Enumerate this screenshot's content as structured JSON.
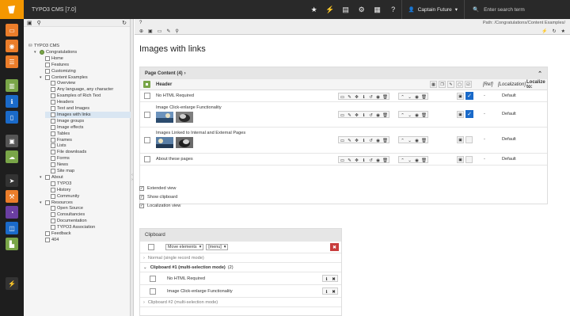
{
  "app": {
    "title": "TYPO3 CMS [7.0]"
  },
  "topbar": {
    "icons": [
      "bookmark-star-icon",
      "flash-icon",
      "documents-icon",
      "gear-icon",
      "grid-icon",
      "help-icon"
    ],
    "user": "Captain Future",
    "search_placeholder": "Enter search term"
  },
  "modules": [
    {
      "name": "page-module-icon",
      "color": "#eb7d2a"
    },
    {
      "name": "view-module-icon",
      "color": "#eb7d2a"
    },
    {
      "name": "list-module-icon",
      "color": "#eb7d2a"
    },
    {
      "name": "workspaces-module-icon",
      "color": "#79a548"
    },
    {
      "name": "info-module-icon",
      "color": "#1a6ac9"
    },
    {
      "name": "template-module-icon",
      "color": "#1a6ac9"
    },
    {
      "name": "filelist-module-icon",
      "color": "#555555"
    },
    {
      "name": "extension-module-icon",
      "color": "#79a548"
    },
    {
      "name": "launch-module-icon",
      "color": "#333333"
    },
    {
      "name": "install-module-icon",
      "color": "#eb7d2a"
    },
    {
      "name": "scheduler-module-icon",
      "color": "#6a3ea1"
    },
    {
      "name": "users-module-icon",
      "color": "#1a6ac9"
    },
    {
      "name": "reports-module-icon",
      "color": "#79a548"
    },
    {
      "name": "plug-icon",
      "color": "#333333"
    }
  ],
  "tree": {
    "root": "TYPO3 CMS",
    "nodes": [
      {
        "label": "Congratulations",
        "level": 1,
        "expanded": true
      },
      {
        "label": "Home",
        "level": 2
      },
      {
        "label": "Features",
        "level": 2
      },
      {
        "label": "Customizing",
        "level": 2
      },
      {
        "label": "Content Examples",
        "level": 2,
        "expanded": true
      },
      {
        "label": "Overview",
        "level": 3
      },
      {
        "label": "Any language, any character",
        "level": 3
      },
      {
        "label": "Examples of Rich Text",
        "level": 3
      },
      {
        "label": "Headers",
        "level": 3
      },
      {
        "label": "Text and Images",
        "level": 3
      },
      {
        "label": "Images with links",
        "level": 3,
        "selected": true
      },
      {
        "label": "Image groups",
        "level": 3
      },
      {
        "label": "Image effects",
        "level": 3
      },
      {
        "label": "Tables",
        "level": 3
      },
      {
        "label": "Frames",
        "level": 3
      },
      {
        "label": "Lists",
        "level": 3
      },
      {
        "label": "File downloads",
        "level": 3
      },
      {
        "label": "Forms",
        "level": 3
      },
      {
        "label": "News",
        "level": 3
      },
      {
        "label": "Site map",
        "level": 3
      },
      {
        "label": "About",
        "level": 2,
        "expanded": true
      },
      {
        "label": "TYPO3",
        "level": 3
      },
      {
        "label": "History",
        "level": 3
      },
      {
        "label": "Community",
        "level": 3
      },
      {
        "label": "Resources",
        "level": 2,
        "expanded": true
      },
      {
        "label": "Open Source",
        "level": 3
      },
      {
        "label": "Consultancies",
        "level": 3
      },
      {
        "label": "Documentation",
        "level": 3
      },
      {
        "label": "TYPO3 Association",
        "level": 3
      },
      {
        "label": "Feedback",
        "level": 2
      },
      {
        "label": "404",
        "level": 2
      }
    ]
  },
  "docheader": {
    "path": "Path: /Congratulations/Content Examples/"
  },
  "page": {
    "title": "Images with links",
    "panel_title": "Page Content (4)",
    "col_header": "Header",
    "col_ref": "[Ref]",
    "col_localization": "[Localization]",
    "col_localize_to": "Localize to:",
    "rows": [
      {
        "title": "No HTML Required",
        "checked": true,
        "lang": "Default"
      },
      {
        "title": "Image Click-enlarge Functionality",
        "checked": true,
        "lang": "Default"
      },
      {
        "title": "Images Linked to Internal and External Pages",
        "checked": false,
        "lang": "Default"
      },
      {
        "title": "About these pages",
        "checked": false,
        "lang": "Default"
      }
    ],
    "dash": "-",
    "options": [
      "Extended view",
      "Show clipboard",
      "Localization view"
    ]
  },
  "clipboard": {
    "title": "Clipboard",
    "move_select": "Move elements",
    "menu_select": "[menu]",
    "normal_label": "Normal (single record mode)",
    "clip1_label": "Clipboard #1 (multi-selection mode)",
    "clip1_count": "(2)",
    "items": [
      "No HTML Required",
      "Image Click-enlarge Functionality"
    ],
    "clip2_label": "Clipboard #2 (multi-selection mode)"
  },
  "colors": {
    "accent": "#f49700",
    "topbar": "#292929",
    "check": "#1a6ac9",
    "danger": "#c83c3c"
  }
}
